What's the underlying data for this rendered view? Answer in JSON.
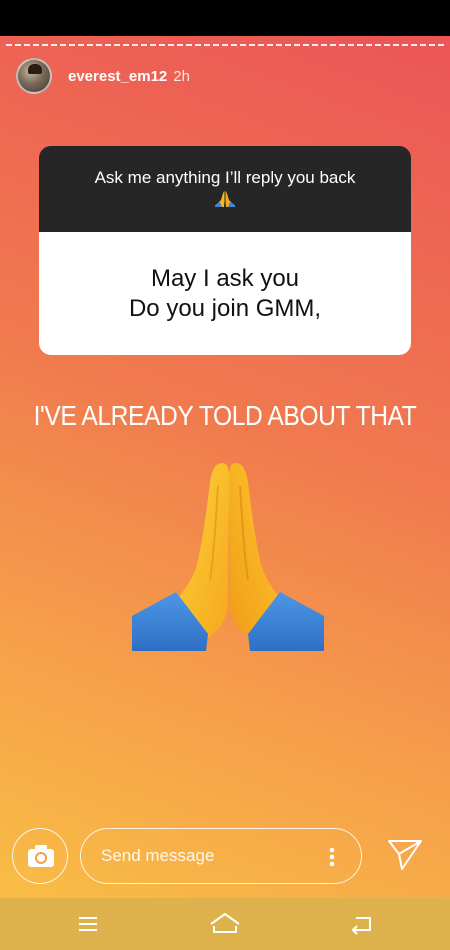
{
  "story": {
    "username": "everest_em12",
    "time": "2h",
    "question_prompt": "Ask me anything I’ll reply you back",
    "question_text_line1": "May I ask you",
    "question_text_line2": "Do you join GMM,",
    "caption": "I'VE ALREADY TOLD ABOUT THAT",
    "sticker": "folded-hands-emoji"
  },
  "reply": {
    "placeholder": "Send message"
  },
  "colors": {
    "gradient_top": "#ec5557",
    "gradient_bottom": "#f9bd46",
    "card_header": "#262626",
    "nav_bar": "#ddb14b"
  }
}
